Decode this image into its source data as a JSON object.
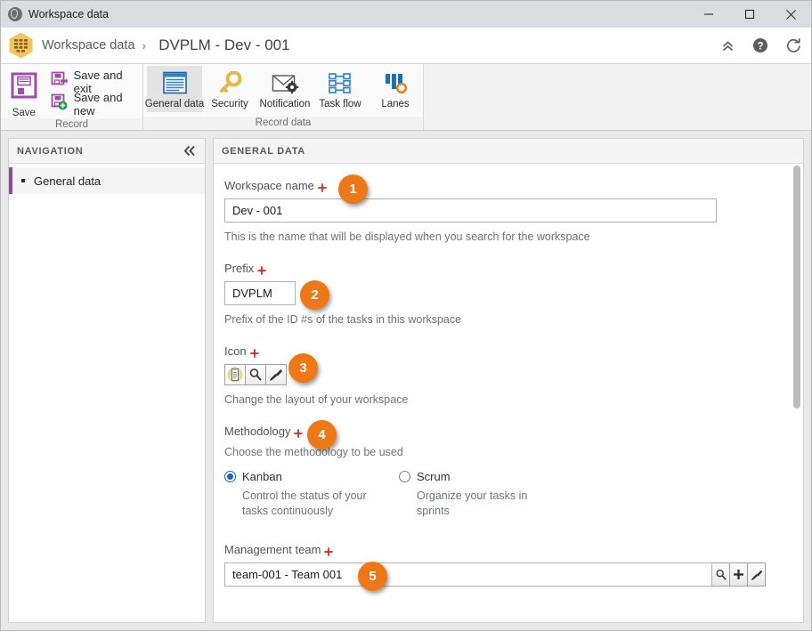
{
  "window": {
    "title": "Workspace data",
    "icon": "globe-icon",
    "controls": {
      "minimize": "—",
      "maximize": "□",
      "close": "✕"
    }
  },
  "header": {
    "app_icon": "workspace-hex-icon",
    "breadcrumb_root": "Workspace data",
    "breadcrumb_separator": "›",
    "breadcrumb_current": "DVPLM - Dev - 001",
    "actions": [
      {
        "name": "collapse-ribbon-icon",
        "glyph": "chevrons-up"
      },
      {
        "name": "help-icon",
        "glyph": "question-circle"
      },
      {
        "name": "refresh-icon",
        "glyph": "refresh"
      }
    ]
  },
  "ribbon": {
    "groups": [
      {
        "title": "Record",
        "big_button": {
          "label": "Save",
          "icon": "floppy-disk-icon"
        },
        "small_buttons": [
          {
            "label": "Save and exit",
            "icon": "save-exit-icon"
          },
          {
            "label": "Save and new",
            "icon": "save-new-icon"
          }
        ]
      },
      {
        "title": "Record data",
        "tabs": [
          {
            "label": "General data",
            "icon": "document-lines-icon",
            "active": true
          },
          {
            "label": "Security",
            "icon": "key-icon",
            "active": false
          },
          {
            "label": "Notification",
            "icon": "envelope-gear-icon",
            "active": false
          },
          {
            "label": "Task flow",
            "icon": "task-flow-icon",
            "active": false
          },
          {
            "label": "Lanes",
            "icon": "lanes-icon",
            "active": false
          }
        ]
      }
    ]
  },
  "navigation": {
    "panel_title": "NAVIGATION",
    "collapse_icon": "chevrons-left-icon",
    "items": [
      {
        "label": "General data",
        "selected": true
      }
    ]
  },
  "content": {
    "panel_title": "GENERAL DATA",
    "fields": {
      "workspace_name": {
        "label": "Workspace name",
        "required": true,
        "value": "Dev - 001",
        "hint": "This is the name that will be displayed when you search for the workspace",
        "badge": "1"
      },
      "prefix": {
        "label": "Prefix",
        "required": true,
        "value": "DVPLM",
        "hint": "Prefix of the ID #s of the tasks in this workspace",
        "badge": "2"
      },
      "icon": {
        "label": "Icon",
        "required": true,
        "hint": "Change the layout of your workspace",
        "badge": "3",
        "buttons": [
          {
            "name": "icon-preview-button",
            "icon": "clipboard-icon"
          },
          {
            "name": "icon-search-button",
            "icon": "magnifier-icon"
          },
          {
            "name": "icon-clear-button",
            "icon": "brush-icon"
          }
        ]
      },
      "methodology": {
        "label": "Methodology",
        "required": true,
        "hint": "Choose the methodology to be used",
        "badge": "4",
        "options": [
          {
            "label": "Kanban",
            "description": "Control the status of your tasks continuously",
            "selected": true
          },
          {
            "label": "Scrum",
            "description": "Organize your tasks in sprints",
            "selected": false
          }
        ]
      },
      "management_team": {
        "label": "Management team",
        "required": true,
        "value": "team-001 - Team 001",
        "badge": "5",
        "buttons": [
          {
            "name": "team-search-button",
            "icon": "magnifier-icon"
          },
          {
            "name": "team-add-button",
            "icon": "plus-icon"
          },
          {
            "name": "team-clear-button",
            "icon": "brush-icon"
          }
        ]
      }
    }
  },
  "colors": {
    "badge_orange": "#ee7816",
    "accent_purple": "#8e4ca0",
    "accent_blue": "#1565c0",
    "required_red": "#cf2b2b"
  }
}
